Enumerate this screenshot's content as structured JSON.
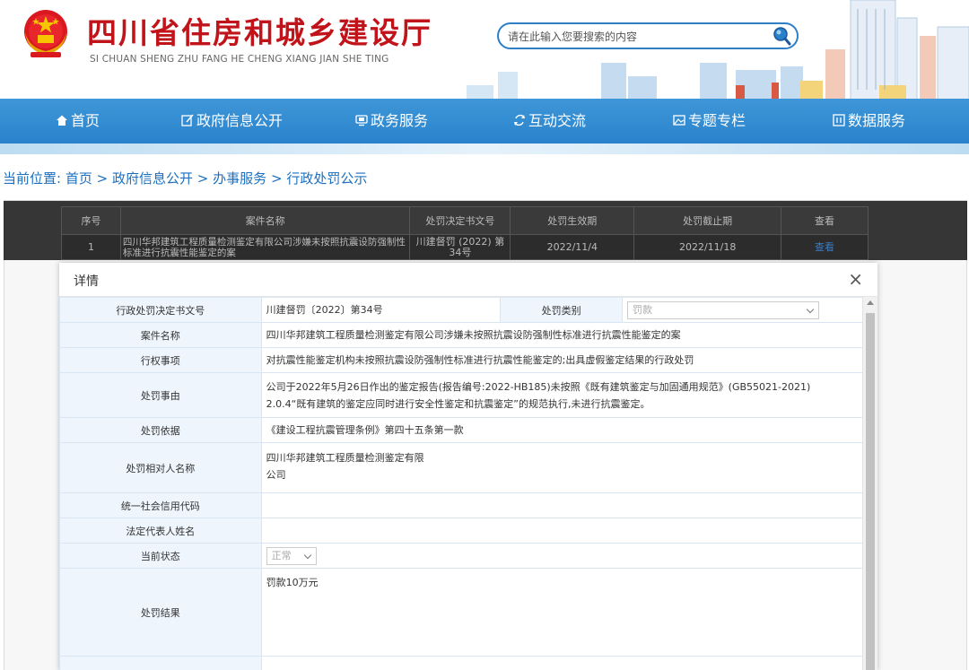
{
  "header": {
    "title": "四川省住房和城乡建设厅",
    "subtitle": "SI CHUAN SHENG ZHU FANG HE CHENG XIANG JIAN SHE TING",
    "search_placeholder": "请在此输入您要搜索的内容"
  },
  "nav": {
    "items": [
      {
        "label": "首页",
        "icon": "home-icon"
      },
      {
        "label": "政府信息公开",
        "icon": "edit-icon"
      },
      {
        "label": "政务服务",
        "icon": "monitor-icon"
      },
      {
        "label": "互动交流",
        "icon": "exchange-icon"
      },
      {
        "label": "专题专栏",
        "icon": "image-icon"
      },
      {
        "label": "数据服务",
        "icon": "data-icon"
      }
    ]
  },
  "breadcrumb": {
    "prefix": "当前位置:",
    "items": [
      "首页",
      "政府信息公开",
      "办事服务",
      "行政处罚公示"
    ],
    "separator": ">"
  },
  "list": {
    "headers": [
      "序号",
      "案件名称",
      "处罚决定书文号",
      "处罚生效期",
      "处罚截止期",
      "查看"
    ],
    "rows": [
      {
        "no": "1",
        "name": "四川华邦建筑工程质量检测鉴定有限公司涉嫌未按照抗震设防强制性标准进行抗震性能鉴定的案",
        "doc": "川建督罚 (2022) 第34号",
        "start": "2022/11/4",
        "end": "2022/11/18",
        "view": "查看"
      }
    ]
  },
  "modal": {
    "title": "详情",
    "close": "×",
    "fields": {
      "decision_no_label": "行政处罚决定书文号",
      "decision_no": "川建督罚〔2022〕第34号",
      "category_label": "处罚类别",
      "category": "罚款",
      "case_name_label": "案件名称",
      "case_name": "四川华邦建筑工程质量检测鉴定有限公司涉嫌未按照抗震设防强制性标准进行抗震性能鉴定的案",
      "power_label": "行权事项",
      "power": "对抗震性能鉴定机构未按照抗震设防强制性标准进行抗震性能鉴定的;出具虚假鉴定结果的行政处罚",
      "reason_label": "处罚事由",
      "reason_line1": "公司于2022年5月26日作出的鉴定报告(报告编号:2022-HB185)未按照《既有建筑鉴定与加固通用规范》(GB55021-2021)",
      "reason_line2": "2.0.4“既有建筑的鉴定应同时进行安全性鉴定和抗震鉴定”的规范执行,未进行抗震鉴定。",
      "basis_label": "处罚依据",
      "basis": "《建设工程抗震管理条例》第四十五条第一款",
      "party_label": "处罚相对人名称",
      "party_line1": "四川华邦建筑工程质量检测鉴定有限",
      "party_line2": "公司",
      "credit_code_label": "统一社会信用代码",
      "credit_code": "",
      "legal_rep_label": "法定代表人姓名",
      "legal_rep": "",
      "status_label": "当前状态",
      "status": "正常",
      "result_label": "处罚结果",
      "result": "罚款10万元"
    }
  },
  "colors": {
    "title_red": "#c0141a",
    "nav_blue": "#2a82cc",
    "link_blue": "#1d6fbf",
    "label_bg": "#eef5fc"
  }
}
